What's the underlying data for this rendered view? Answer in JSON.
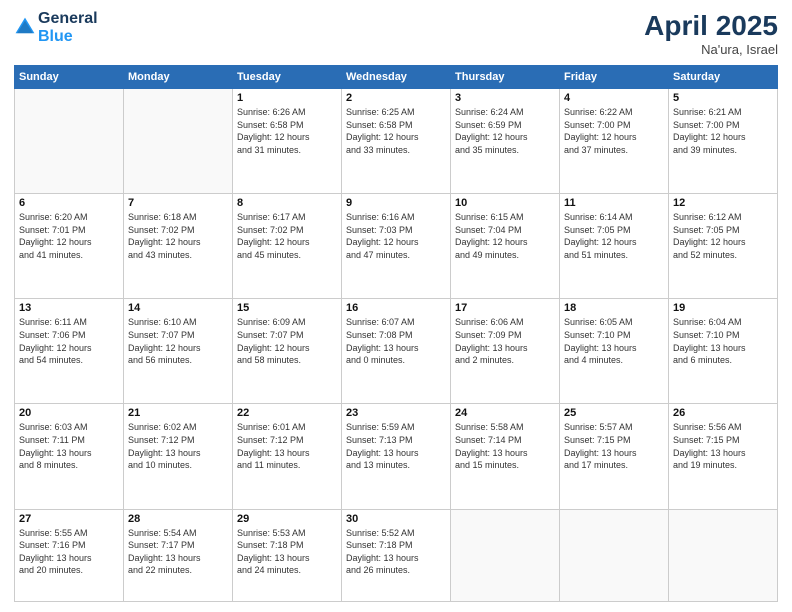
{
  "logo": {
    "line1": "General",
    "line2": "Blue"
  },
  "header": {
    "month": "April 2025",
    "location": "Na'ura, Israel"
  },
  "weekdays": [
    "Sunday",
    "Monday",
    "Tuesday",
    "Wednesday",
    "Thursday",
    "Friday",
    "Saturday"
  ],
  "weeks": [
    [
      {
        "day": "",
        "info": ""
      },
      {
        "day": "",
        "info": ""
      },
      {
        "day": "1",
        "info": "Sunrise: 6:26 AM\nSunset: 6:58 PM\nDaylight: 12 hours\nand 31 minutes."
      },
      {
        "day": "2",
        "info": "Sunrise: 6:25 AM\nSunset: 6:58 PM\nDaylight: 12 hours\nand 33 minutes."
      },
      {
        "day": "3",
        "info": "Sunrise: 6:24 AM\nSunset: 6:59 PM\nDaylight: 12 hours\nand 35 minutes."
      },
      {
        "day": "4",
        "info": "Sunrise: 6:22 AM\nSunset: 7:00 PM\nDaylight: 12 hours\nand 37 minutes."
      },
      {
        "day": "5",
        "info": "Sunrise: 6:21 AM\nSunset: 7:00 PM\nDaylight: 12 hours\nand 39 minutes."
      }
    ],
    [
      {
        "day": "6",
        "info": "Sunrise: 6:20 AM\nSunset: 7:01 PM\nDaylight: 12 hours\nand 41 minutes."
      },
      {
        "day": "7",
        "info": "Sunrise: 6:18 AM\nSunset: 7:02 PM\nDaylight: 12 hours\nand 43 minutes."
      },
      {
        "day": "8",
        "info": "Sunrise: 6:17 AM\nSunset: 7:02 PM\nDaylight: 12 hours\nand 45 minutes."
      },
      {
        "day": "9",
        "info": "Sunrise: 6:16 AM\nSunset: 7:03 PM\nDaylight: 12 hours\nand 47 minutes."
      },
      {
        "day": "10",
        "info": "Sunrise: 6:15 AM\nSunset: 7:04 PM\nDaylight: 12 hours\nand 49 minutes."
      },
      {
        "day": "11",
        "info": "Sunrise: 6:14 AM\nSunset: 7:05 PM\nDaylight: 12 hours\nand 51 minutes."
      },
      {
        "day": "12",
        "info": "Sunrise: 6:12 AM\nSunset: 7:05 PM\nDaylight: 12 hours\nand 52 minutes."
      }
    ],
    [
      {
        "day": "13",
        "info": "Sunrise: 6:11 AM\nSunset: 7:06 PM\nDaylight: 12 hours\nand 54 minutes."
      },
      {
        "day": "14",
        "info": "Sunrise: 6:10 AM\nSunset: 7:07 PM\nDaylight: 12 hours\nand 56 minutes."
      },
      {
        "day": "15",
        "info": "Sunrise: 6:09 AM\nSunset: 7:07 PM\nDaylight: 12 hours\nand 58 minutes."
      },
      {
        "day": "16",
        "info": "Sunrise: 6:07 AM\nSunset: 7:08 PM\nDaylight: 13 hours\nand 0 minutes."
      },
      {
        "day": "17",
        "info": "Sunrise: 6:06 AM\nSunset: 7:09 PM\nDaylight: 13 hours\nand 2 minutes."
      },
      {
        "day": "18",
        "info": "Sunrise: 6:05 AM\nSunset: 7:10 PM\nDaylight: 13 hours\nand 4 minutes."
      },
      {
        "day": "19",
        "info": "Sunrise: 6:04 AM\nSunset: 7:10 PM\nDaylight: 13 hours\nand 6 minutes."
      }
    ],
    [
      {
        "day": "20",
        "info": "Sunrise: 6:03 AM\nSunset: 7:11 PM\nDaylight: 13 hours\nand 8 minutes."
      },
      {
        "day": "21",
        "info": "Sunrise: 6:02 AM\nSunset: 7:12 PM\nDaylight: 13 hours\nand 10 minutes."
      },
      {
        "day": "22",
        "info": "Sunrise: 6:01 AM\nSunset: 7:12 PM\nDaylight: 13 hours\nand 11 minutes."
      },
      {
        "day": "23",
        "info": "Sunrise: 5:59 AM\nSunset: 7:13 PM\nDaylight: 13 hours\nand 13 minutes."
      },
      {
        "day": "24",
        "info": "Sunrise: 5:58 AM\nSunset: 7:14 PM\nDaylight: 13 hours\nand 15 minutes."
      },
      {
        "day": "25",
        "info": "Sunrise: 5:57 AM\nSunset: 7:15 PM\nDaylight: 13 hours\nand 17 minutes."
      },
      {
        "day": "26",
        "info": "Sunrise: 5:56 AM\nSunset: 7:15 PM\nDaylight: 13 hours\nand 19 minutes."
      }
    ],
    [
      {
        "day": "27",
        "info": "Sunrise: 5:55 AM\nSunset: 7:16 PM\nDaylight: 13 hours\nand 20 minutes."
      },
      {
        "day": "28",
        "info": "Sunrise: 5:54 AM\nSunset: 7:17 PM\nDaylight: 13 hours\nand 22 minutes."
      },
      {
        "day": "29",
        "info": "Sunrise: 5:53 AM\nSunset: 7:18 PM\nDaylight: 13 hours\nand 24 minutes."
      },
      {
        "day": "30",
        "info": "Sunrise: 5:52 AM\nSunset: 7:18 PM\nDaylight: 13 hours\nand 26 minutes."
      },
      {
        "day": "",
        "info": ""
      },
      {
        "day": "",
        "info": ""
      },
      {
        "day": "",
        "info": ""
      }
    ]
  ]
}
